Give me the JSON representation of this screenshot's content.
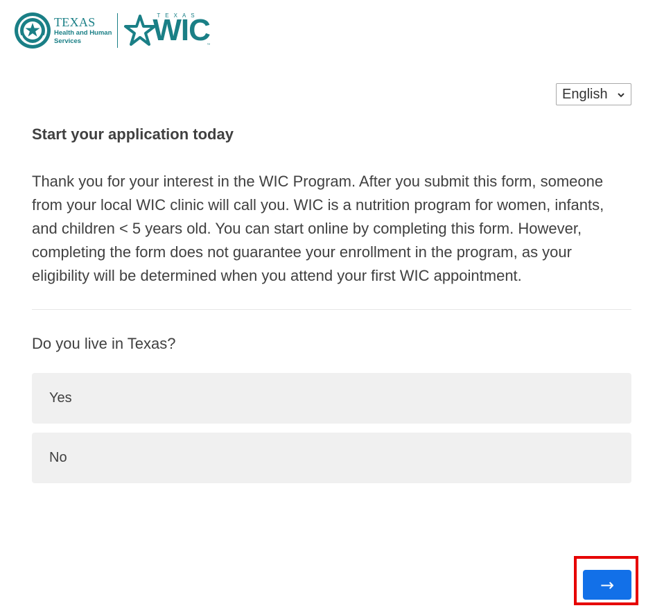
{
  "header": {
    "hhs_logo": {
      "state": "TEXAS",
      "line1": "Health and Human",
      "line2": "Services",
      "icon": "texas-seal-icon"
    },
    "wic_logo": {
      "top_text": "TEXAS",
      "word": "WIC",
      "tm": "™",
      "icon": "star-icon"
    },
    "brand_color": "#1a7f86"
  },
  "language": {
    "selected": "English",
    "icon": "chevron-down-icon"
  },
  "content": {
    "title": "Start your application today",
    "intro": "Thank you for your interest in the WIC Program. After you submit this form, someone from your local WIC clinic will call you. WIC is a nutrition program for women, infants, and children < 5 years old. You can start online by completing this form. However, completing the form does not guarantee your enrollment in the program, as your eligibility will be determined when you attend your first WIC appointment.",
    "question": "Do you live in Texas?",
    "options": [
      {
        "label": "Yes"
      },
      {
        "label": "No"
      }
    ]
  },
  "navigation": {
    "next_label": "→",
    "next_color": "#1270e8",
    "highlight_color": "#e60000"
  }
}
